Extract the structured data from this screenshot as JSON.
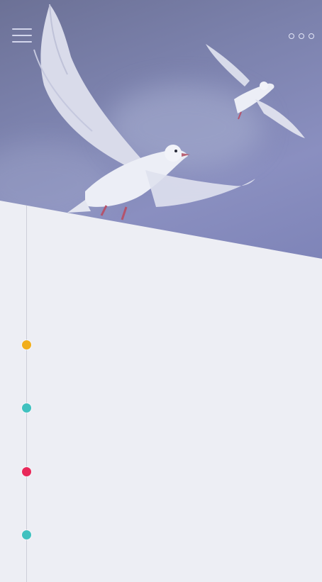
{
  "header": {
    "menu_icon": "hamburger-menu-icon",
    "more_icon": "more-dots-icon",
    "hero_image": "seagulls-photo"
  },
  "timeline": {
    "items": [
      {
        "color": "#f1ae1c",
        "label": ""
      },
      {
        "color": "#40c1bf",
        "label": ""
      },
      {
        "color": "#e8285a",
        "label": ""
      },
      {
        "color": "#40c1bf",
        "label": ""
      }
    ]
  },
  "colors": {
    "accent_yellow": "#f1ae1c",
    "accent_teal": "#40c1bf",
    "accent_pink": "#e8285a",
    "panel_background": "#edeef4",
    "hero_tint": "#7c82ad"
  }
}
